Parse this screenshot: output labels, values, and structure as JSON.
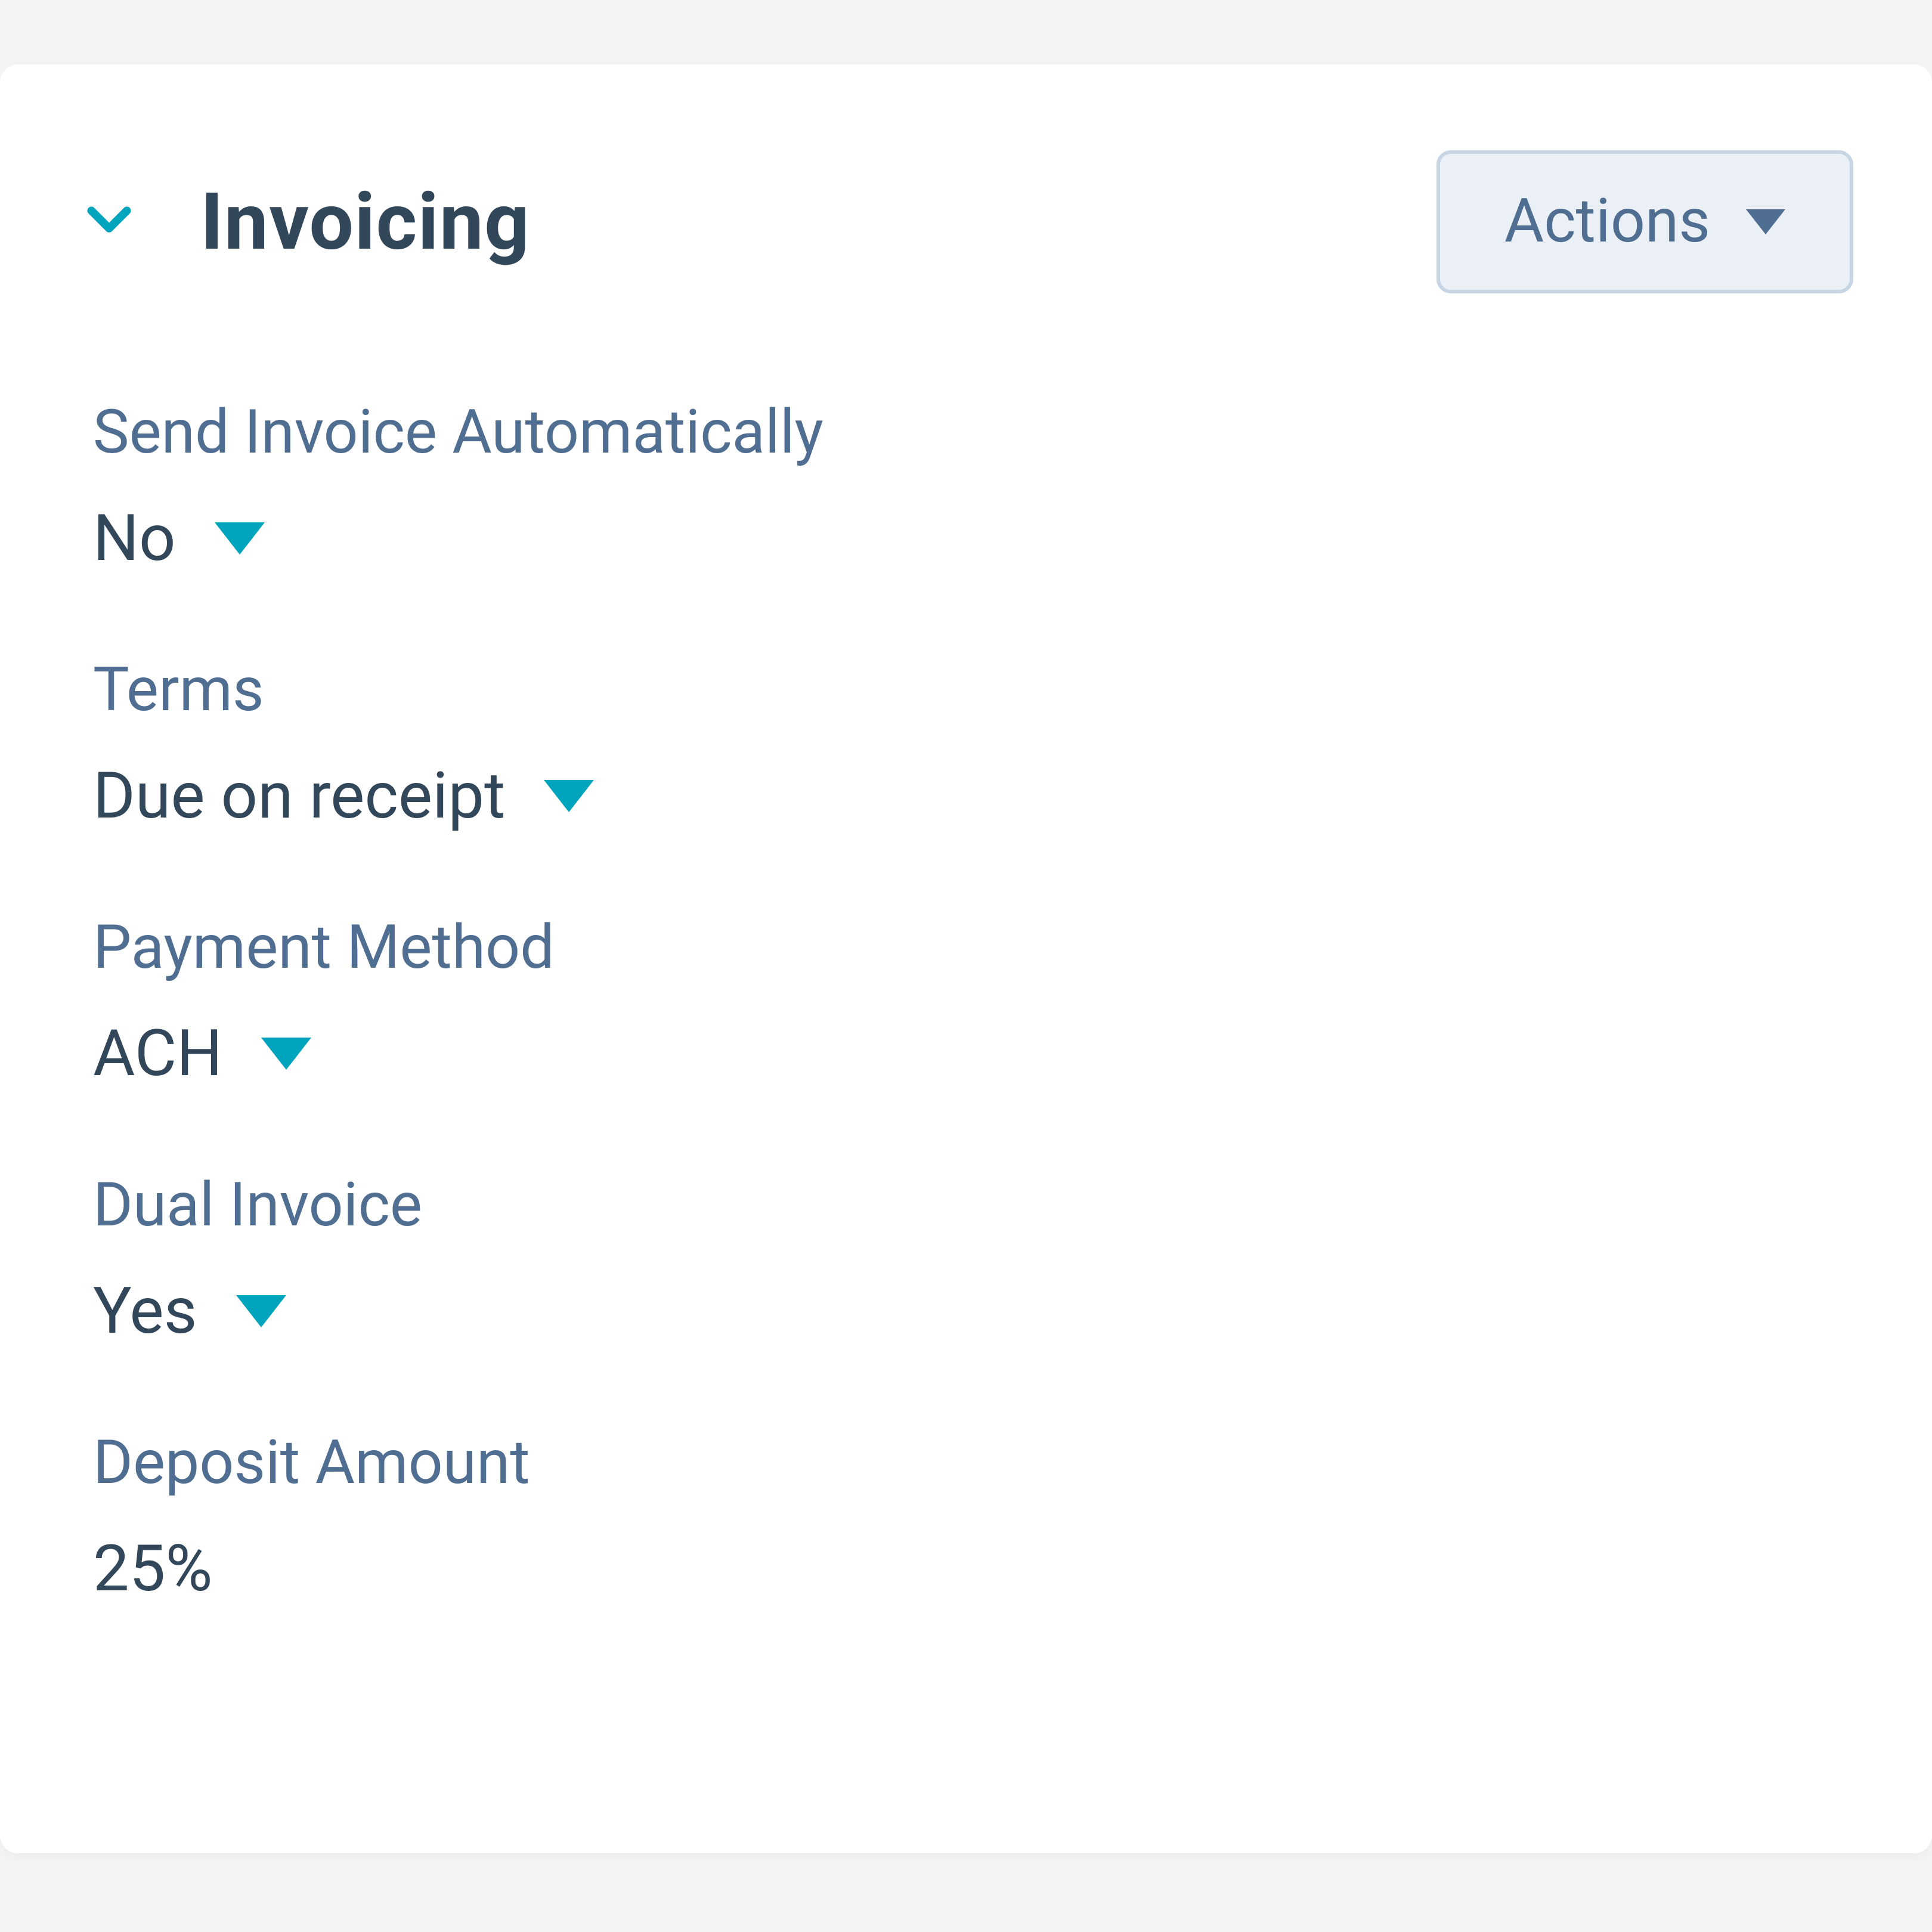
{
  "header": {
    "title": "Invoicing",
    "actions_label": "Actions"
  },
  "colors": {
    "accent": "#00a4bd",
    "text_heading": "#33475b",
    "text_label": "#506e91",
    "btn_bg": "#eaf0f6",
    "btn_border": "#c8d6e4"
  },
  "fields": [
    {
      "key": "send_auto",
      "label": "Send Invoice Automatically",
      "value": "No",
      "type": "dropdown"
    },
    {
      "key": "terms",
      "label": "Terms",
      "value": "Due on receipt",
      "type": "dropdown"
    },
    {
      "key": "payment_method",
      "label": "Payment Method",
      "value": "ACH",
      "type": "dropdown"
    },
    {
      "key": "dual_invoice",
      "label": "Dual Invoice",
      "value": "Yes",
      "type": "dropdown"
    },
    {
      "key": "deposit_amount",
      "label": "Deposit Amount",
      "value": "25%",
      "type": "static"
    }
  ]
}
